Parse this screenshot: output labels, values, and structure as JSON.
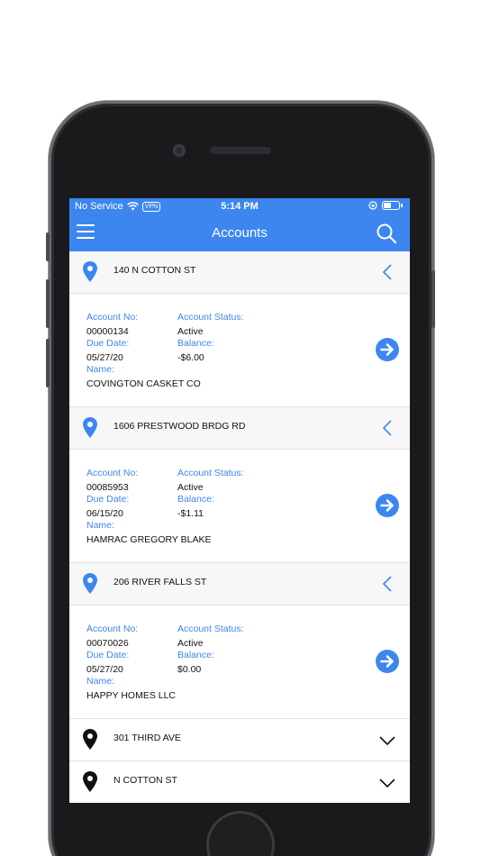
{
  "status_bar": {
    "carrier": "No Service",
    "vpn": "VPN",
    "time": "5:14 PM"
  },
  "nav": {
    "title": "Accounts",
    "menu_icon": "hamburger-icon",
    "search_icon": "search-icon"
  },
  "colors": {
    "accent": "#3d86f0",
    "text": "#111111",
    "row_bg": "#f7f7f7"
  },
  "labels": {
    "account_no": "Account No:",
    "account_status": "Account Status:",
    "due_date": "Due Date:",
    "balance": "Balance:",
    "name": "Name:"
  },
  "groups": [
    {
      "address": "140 N COTTON ST",
      "expanded": true,
      "account": {
        "account_no": "00000134",
        "status": "Active",
        "due_date": "05/27/20",
        "balance": "-$6.00",
        "name": "COVINGTON CASKET CO"
      }
    },
    {
      "address": "1606 PRESTWOOD BRDG RD",
      "expanded": true,
      "account": {
        "account_no": "00085953",
        "status": "Active",
        "due_date": "06/15/20",
        "balance": "-$1.11",
        "name": "HAMRAC GREGORY BLAKE"
      }
    },
    {
      "address": "206 RIVER FALLS ST",
      "expanded": true,
      "account": {
        "account_no": "00070026",
        "status": "Active",
        "due_date": "05/27/20",
        "balance": "$0.00",
        "name": "HAPPY HOMES LLC"
      }
    },
    {
      "address": "301 THIRD AVE",
      "expanded": false
    },
    {
      "address": "N COTTON ST",
      "expanded": false
    }
  ]
}
